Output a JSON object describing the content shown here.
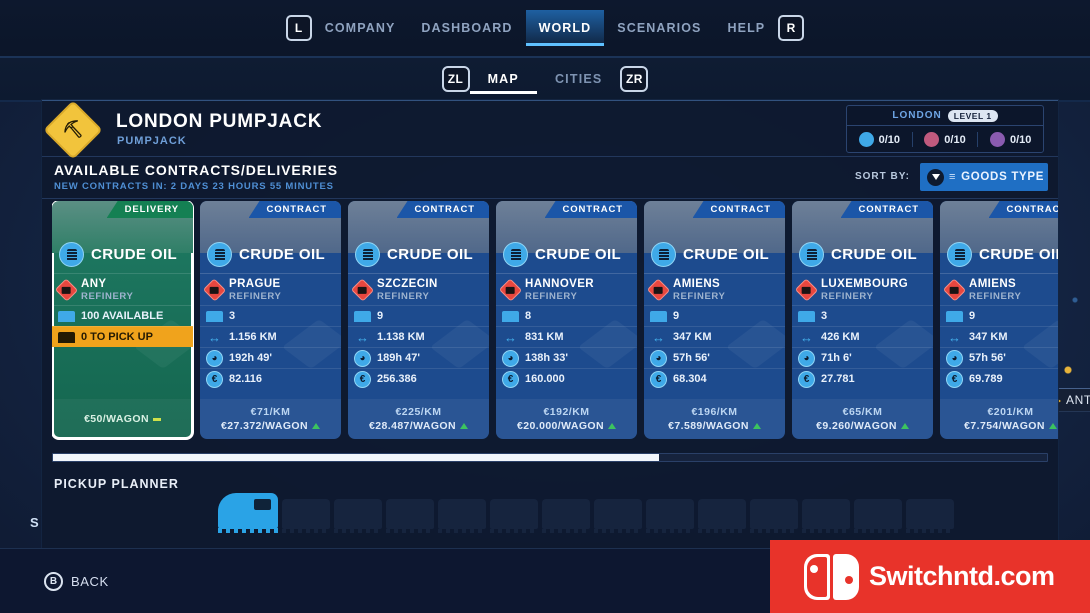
{
  "topnav": {
    "left_shoulder": "L",
    "right_shoulder": "R",
    "items": [
      {
        "label": "COMPANY",
        "active": false
      },
      {
        "label": "DASHBOARD",
        "active": false
      },
      {
        "label": "WORLD",
        "active": true
      },
      {
        "label": "SCENARIOS",
        "active": false
      },
      {
        "label": "HELP",
        "active": false
      }
    ]
  },
  "subnav": {
    "left_shoulder": "ZL",
    "right_shoulder": "ZR",
    "items": [
      {
        "label": "MAP",
        "active": true
      },
      {
        "label": "CITIES",
        "active": false
      }
    ]
  },
  "header": {
    "site_title": "LONDON PUMPJACK",
    "site_subtitle": "PUMPJACK",
    "site_icon": "pumpjack-icon",
    "level_city": "LONDON",
    "level_pill": "LEVEL 1",
    "resources": [
      {
        "name": "resource-oil",
        "value": "0/10",
        "color": "#3fa9e8"
      },
      {
        "name": "resource-red",
        "value": "0/10",
        "color": "#c05a7e"
      },
      {
        "name": "resource-purple",
        "value": "0/10",
        "color": "#8a5bb0"
      }
    ]
  },
  "contracts": {
    "title": "AVAILABLE CONTRACTS/DELIVERIES",
    "subtitle": "NEW CONTRACTS IN: 2 DAYS 23 HOURS 55 MINUTES",
    "sort_label": "SORT BY:",
    "sort_value": "GOODS TYPE",
    "cards": [
      {
        "tab": "DELIVERY",
        "type": "delivery",
        "selected": true,
        "goods": "CRUDE OIL",
        "dest": "ANY",
        "dest_sub": "REFINERY",
        "wagons": "100 AVAILABLE",
        "pickup": "0 TO PICK UP",
        "foot_wagon": "€50/WAGON"
      },
      {
        "tab": "CONTRACT",
        "type": "contract",
        "selected": false,
        "goods": "CRUDE OIL",
        "dest": "PRAGUE",
        "dest_sub": "REFINERY",
        "wagons": "3",
        "distance": "1.156 KM",
        "time": "192h 49'",
        "money": "82.116",
        "foot_km": "€71/KM",
        "foot_wagon": "€27.372/WAGON"
      },
      {
        "tab": "CONTRACT",
        "type": "contract",
        "selected": false,
        "goods": "CRUDE OIL",
        "dest": "SZCZECIN",
        "dest_sub": "REFINERY",
        "wagons": "9",
        "distance": "1.138 KM",
        "time": "189h 47'",
        "money": "256.386",
        "foot_km": "€225/KM",
        "foot_wagon": "€28.487/WAGON"
      },
      {
        "tab": "CONTRACT",
        "type": "contract",
        "selected": false,
        "goods": "CRUDE OIL",
        "dest": "HANNOVER",
        "dest_sub": "REFINERY",
        "wagons": "8",
        "distance": "831 KM",
        "time": "138h 33'",
        "money": "160.000",
        "foot_km": "€192/KM",
        "foot_wagon": "€20.000/WAGON"
      },
      {
        "tab": "CONTRACT",
        "type": "contract",
        "selected": false,
        "goods": "CRUDE OIL",
        "dest": "AMIENS",
        "dest_sub": "REFINERY",
        "wagons": "9",
        "distance": "347 KM",
        "time": "57h 56'",
        "money": "68.304",
        "foot_km": "€196/KM",
        "foot_wagon": "€7.589/WAGON"
      },
      {
        "tab": "CONTRACT",
        "type": "contract",
        "selected": false,
        "goods": "CRUDE OIL",
        "dest": "LUXEMBOURG",
        "dest_sub": "REFINERY",
        "wagons": "3",
        "distance": "426 KM",
        "time": "71h 6'",
        "money": "27.781",
        "foot_km": "€65/KM",
        "foot_wagon": "€9.260/WAGON"
      },
      {
        "tab": "CONTRACT",
        "type": "contract",
        "selected": false,
        "goods": "CRUDE OIL",
        "dest": "AMIENS",
        "dest_sub": "REFINERY",
        "wagons": "9",
        "distance": "347 KM",
        "time": "57h 56'",
        "money": "69.789",
        "foot_km": "€201/KM",
        "foot_wagon": "€7.754/WAGON"
      }
    ]
  },
  "planner": {
    "label": "PICKUP PLANNER",
    "wagon_slots": 13,
    "scroll_percent": 61
  },
  "map": {
    "label": "ANTW"
  },
  "bottom": {
    "button": "B",
    "label": "BACK"
  },
  "watermark": {
    "text": "Switchntd.com"
  },
  "stray_text": "S"
}
